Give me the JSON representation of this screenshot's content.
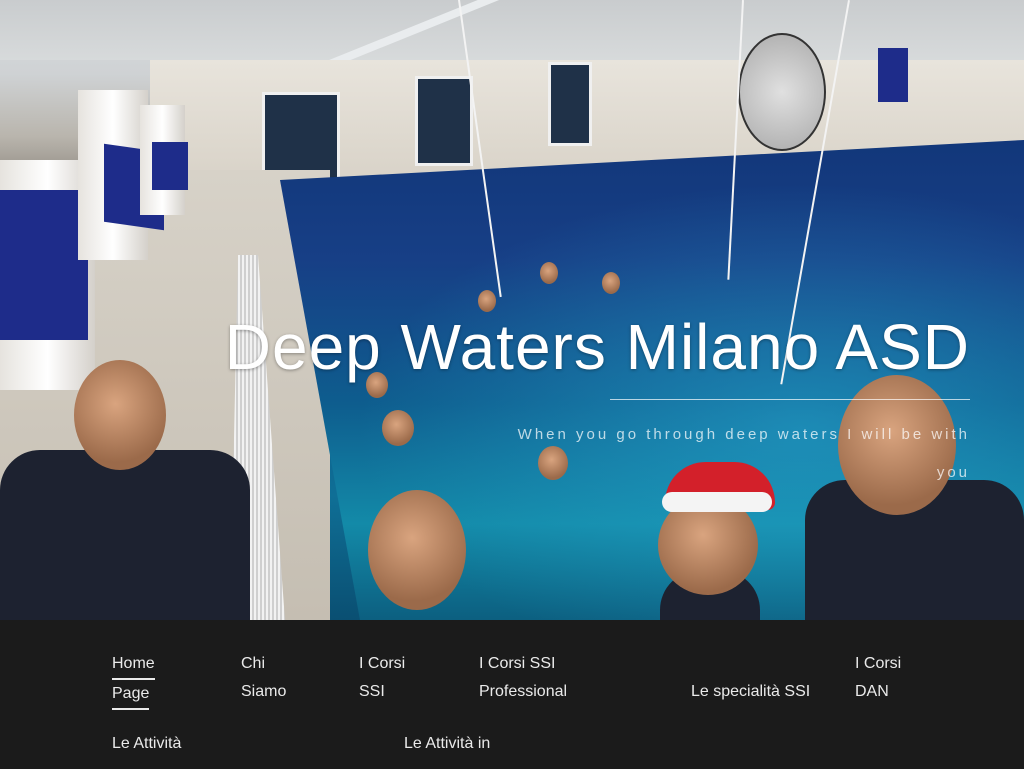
{
  "site": {
    "title": "Deep Waters Milano ASD",
    "tagline": "When you go through deep waters I will be with you"
  },
  "nav": {
    "row1": [
      {
        "label": "Home Page",
        "active": true
      },
      {
        "label": "Chi Siamo"
      },
      {
        "label": "I Corsi SSI"
      },
      {
        "label": "I Corsi SSI Professional"
      },
      {
        "label": "Le specialità SSI"
      },
      {
        "label": "I Corsi DAN"
      }
    ],
    "row2": [
      {
        "label": "Le Attività"
      },
      {
        "label": "Le Attività in"
      }
    ]
  },
  "icons": {
    "logo": "half-circle-logo-icon"
  }
}
